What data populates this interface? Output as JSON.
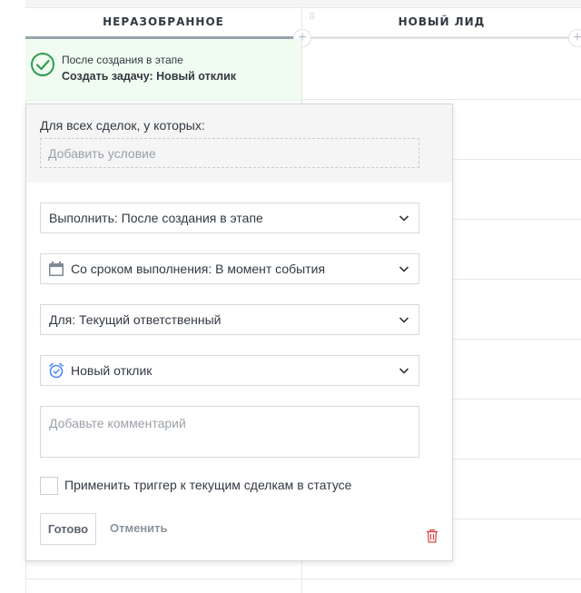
{
  "columns": [
    {
      "title": "НЕРАЗОБРАННОЕ"
    },
    {
      "title": "НОВЫЙ ЛИД"
    }
  ],
  "trigger": {
    "subtitle": "После создания в этапе",
    "title": "Создать задачу: Новый отклик"
  },
  "panel": {
    "condition_label": "Для всех сделок, у которых:",
    "add_condition": "Добавить условие",
    "execute_select": "Выполнить: После создания в этапе",
    "deadline_select": "Со сроком выполнения: В момент события",
    "assignee_select": "Для: Текущий ответственный",
    "task_type_select": "Новый отклик",
    "comment_placeholder": "Добавьте комментарий",
    "apply_checkbox_label": "Применить триггер к текущим сделкам в статусе",
    "apply_checked": false,
    "done_button": "Готово",
    "cancel_button": "Отменить"
  },
  "colors": {
    "trigger_bg": "#f1fcf1",
    "check_green": "#2e9c4f",
    "accent_blue": "#4c8bf5",
    "danger_red": "#e0454d"
  },
  "icons": [
    "check-circle-icon",
    "calendar-icon",
    "alarm-clock-icon",
    "chevron-down-icon",
    "trash-icon",
    "plus-icon",
    "drag-handle-icon"
  ]
}
